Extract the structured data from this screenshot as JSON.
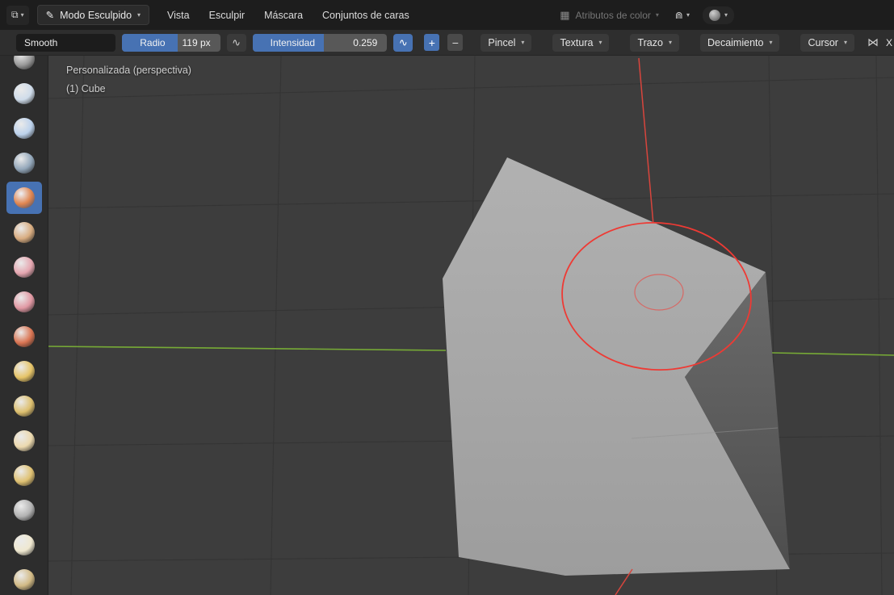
{
  "colors": {
    "accent": "#4772b3",
    "header_bg": "#1d1d1d",
    "tool_header_bg": "#2e2e2e",
    "viewport_bg": "#3d3d3d",
    "axis_x": "#e8463f",
    "axis_y": "#77ab36",
    "cursor_red": "#ee3a34",
    "mesh_light": "#a8a8a8",
    "mesh_dark": "#555555"
  },
  "icons": {
    "chevron_down": "▾",
    "editor": "⧉",
    "mode_pencil": "✎",
    "color_attr": "▦",
    "snap": "⋒",
    "pressure": "∿",
    "symmetry": "⋈",
    "plus": "+",
    "minus": "−"
  },
  "header": {
    "mode_label": "Modo Esculpido",
    "menus": [
      "Vista",
      "Esculpir",
      "Máscara",
      "Conjuntos de caras"
    ],
    "color_attributes_label": "Atributos de color"
  },
  "tool_settings": {
    "brush_name": "Smooth",
    "radius": {
      "label": "Radio",
      "value": "119 px",
      "fill_pct": 57
    },
    "strength": {
      "label": "Intensidad",
      "value": "0.259",
      "fill_pct": 53
    },
    "dropdowns": [
      "Pincel",
      "Textura",
      "Trazo",
      "Decaimiento",
      "Cursor"
    ],
    "symmetry_x_label": "X"
  },
  "viewport": {
    "overlay_line1": "Personalizada (perspectiva)",
    "overlay_line2": "(1) Cube",
    "object_name": "Cube"
  },
  "brushes": [
    {
      "name": "draw",
      "color": "#9a9a9a",
      "selected": false
    },
    {
      "name": "draw-sharp",
      "color": "#cfdcea",
      "selected": false
    },
    {
      "name": "clay",
      "color": "#bcd2ec",
      "selected": false
    },
    {
      "name": "clay-strips",
      "color": "#93a7ba",
      "selected": false
    },
    {
      "name": "smooth",
      "color": "#e0854f",
      "selected": true
    },
    {
      "name": "flatten",
      "color": "#d8ac80",
      "selected": false
    },
    {
      "name": "grab",
      "color": "#e5a6b0",
      "selected": false
    },
    {
      "name": "elastic-deform",
      "color": "#e198a3",
      "selected": false
    },
    {
      "name": "snake-hook",
      "color": "#da7553",
      "selected": false
    },
    {
      "name": "blob",
      "color": "#e6c468",
      "selected": false
    },
    {
      "name": "inflate",
      "color": "#ddbf6e",
      "selected": false
    },
    {
      "name": "crease",
      "color": "#ecd9ae",
      "selected": false
    },
    {
      "name": "thumb",
      "color": "#dfc172",
      "selected": false
    },
    {
      "name": "pinch",
      "color": "#b3b3b3",
      "selected": false
    },
    {
      "name": "cloth",
      "color": "#efe8d0",
      "selected": false
    },
    {
      "name": "scrape",
      "color": "#d2ba85",
      "selected": false
    }
  ]
}
